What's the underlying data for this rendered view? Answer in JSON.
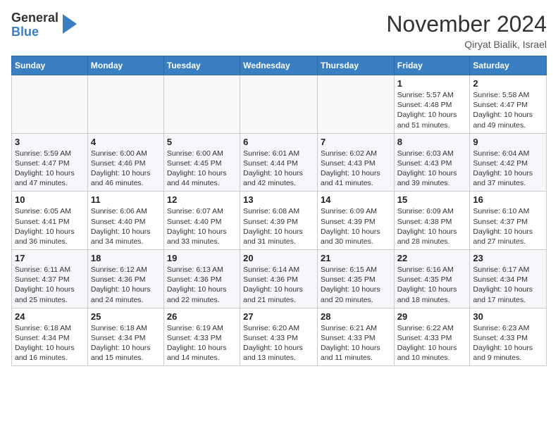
{
  "logo": {
    "general": "General",
    "blue": "Blue"
  },
  "title": "November 2024",
  "location": "Qiryat Bialik, Israel",
  "weekdays": [
    "Sunday",
    "Monday",
    "Tuesday",
    "Wednesday",
    "Thursday",
    "Friday",
    "Saturday"
  ],
  "weeks": [
    [
      {
        "day": "",
        "info": ""
      },
      {
        "day": "",
        "info": ""
      },
      {
        "day": "",
        "info": ""
      },
      {
        "day": "",
        "info": ""
      },
      {
        "day": "",
        "info": ""
      },
      {
        "day": "1",
        "info": "Sunrise: 5:57 AM\nSunset: 4:48 PM\nDaylight: 10 hours\nand 51 minutes."
      },
      {
        "day": "2",
        "info": "Sunrise: 5:58 AM\nSunset: 4:47 PM\nDaylight: 10 hours\nand 49 minutes."
      }
    ],
    [
      {
        "day": "3",
        "info": "Sunrise: 5:59 AM\nSunset: 4:47 PM\nDaylight: 10 hours\nand 47 minutes."
      },
      {
        "day": "4",
        "info": "Sunrise: 6:00 AM\nSunset: 4:46 PM\nDaylight: 10 hours\nand 46 minutes."
      },
      {
        "day": "5",
        "info": "Sunrise: 6:00 AM\nSunset: 4:45 PM\nDaylight: 10 hours\nand 44 minutes."
      },
      {
        "day": "6",
        "info": "Sunrise: 6:01 AM\nSunset: 4:44 PM\nDaylight: 10 hours\nand 42 minutes."
      },
      {
        "day": "7",
        "info": "Sunrise: 6:02 AM\nSunset: 4:43 PM\nDaylight: 10 hours\nand 41 minutes."
      },
      {
        "day": "8",
        "info": "Sunrise: 6:03 AM\nSunset: 4:43 PM\nDaylight: 10 hours\nand 39 minutes."
      },
      {
        "day": "9",
        "info": "Sunrise: 6:04 AM\nSunset: 4:42 PM\nDaylight: 10 hours\nand 37 minutes."
      }
    ],
    [
      {
        "day": "10",
        "info": "Sunrise: 6:05 AM\nSunset: 4:41 PM\nDaylight: 10 hours\nand 36 minutes."
      },
      {
        "day": "11",
        "info": "Sunrise: 6:06 AM\nSunset: 4:40 PM\nDaylight: 10 hours\nand 34 minutes."
      },
      {
        "day": "12",
        "info": "Sunrise: 6:07 AM\nSunset: 4:40 PM\nDaylight: 10 hours\nand 33 minutes."
      },
      {
        "day": "13",
        "info": "Sunrise: 6:08 AM\nSunset: 4:39 PM\nDaylight: 10 hours\nand 31 minutes."
      },
      {
        "day": "14",
        "info": "Sunrise: 6:09 AM\nSunset: 4:39 PM\nDaylight: 10 hours\nand 30 minutes."
      },
      {
        "day": "15",
        "info": "Sunrise: 6:09 AM\nSunset: 4:38 PM\nDaylight: 10 hours\nand 28 minutes."
      },
      {
        "day": "16",
        "info": "Sunrise: 6:10 AM\nSunset: 4:37 PM\nDaylight: 10 hours\nand 27 minutes."
      }
    ],
    [
      {
        "day": "17",
        "info": "Sunrise: 6:11 AM\nSunset: 4:37 PM\nDaylight: 10 hours\nand 25 minutes."
      },
      {
        "day": "18",
        "info": "Sunrise: 6:12 AM\nSunset: 4:36 PM\nDaylight: 10 hours\nand 24 minutes."
      },
      {
        "day": "19",
        "info": "Sunrise: 6:13 AM\nSunset: 4:36 PM\nDaylight: 10 hours\nand 22 minutes."
      },
      {
        "day": "20",
        "info": "Sunrise: 6:14 AM\nSunset: 4:36 PM\nDaylight: 10 hours\nand 21 minutes."
      },
      {
        "day": "21",
        "info": "Sunrise: 6:15 AM\nSunset: 4:35 PM\nDaylight: 10 hours\nand 20 minutes."
      },
      {
        "day": "22",
        "info": "Sunrise: 6:16 AM\nSunset: 4:35 PM\nDaylight: 10 hours\nand 18 minutes."
      },
      {
        "day": "23",
        "info": "Sunrise: 6:17 AM\nSunset: 4:34 PM\nDaylight: 10 hours\nand 17 minutes."
      }
    ],
    [
      {
        "day": "24",
        "info": "Sunrise: 6:18 AM\nSunset: 4:34 PM\nDaylight: 10 hours\nand 16 minutes."
      },
      {
        "day": "25",
        "info": "Sunrise: 6:18 AM\nSunset: 4:34 PM\nDaylight: 10 hours\nand 15 minutes."
      },
      {
        "day": "26",
        "info": "Sunrise: 6:19 AM\nSunset: 4:33 PM\nDaylight: 10 hours\nand 14 minutes."
      },
      {
        "day": "27",
        "info": "Sunrise: 6:20 AM\nSunset: 4:33 PM\nDaylight: 10 hours\nand 13 minutes."
      },
      {
        "day": "28",
        "info": "Sunrise: 6:21 AM\nSunset: 4:33 PM\nDaylight: 10 hours\nand 11 minutes."
      },
      {
        "day": "29",
        "info": "Sunrise: 6:22 AM\nSunset: 4:33 PM\nDaylight: 10 hours\nand 10 minutes."
      },
      {
        "day": "30",
        "info": "Sunrise: 6:23 AM\nSunset: 4:33 PM\nDaylight: 10 hours\nand 9 minutes."
      }
    ]
  ]
}
